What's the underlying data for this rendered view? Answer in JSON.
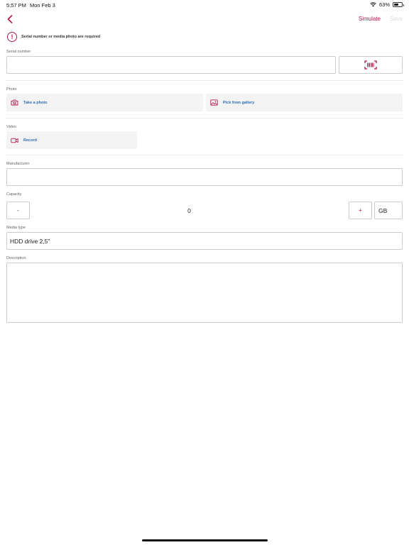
{
  "status_bar": {
    "time": "5:57 PM",
    "date": "Mon Feb 3",
    "battery": "63%",
    "battery_level": 0.63
  },
  "nav": {
    "simulate_label": "Simulate",
    "save_label": "Save"
  },
  "warning": {
    "text": "Serial number or media photo are required"
  },
  "serial": {
    "label": "Serial number",
    "value": ""
  },
  "photo": {
    "label": "Photo",
    "take_label": "Take a photo",
    "gallery_label": "Pick from gallery"
  },
  "video": {
    "label": "Video",
    "record_label": "Record"
  },
  "manufacturer": {
    "label": "Manufacturer",
    "value": ""
  },
  "capacity": {
    "label": "Capacity",
    "minus_label": "-",
    "value": "0",
    "plus_label": "+",
    "unit": "GB"
  },
  "media_type": {
    "label": "Media type",
    "value": "HDD drive 2,5\""
  },
  "description": {
    "label": "Description",
    "value": ""
  },
  "colors": {
    "accent": "#b0174a",
    "link": "#2a6fb5"
  }
}
